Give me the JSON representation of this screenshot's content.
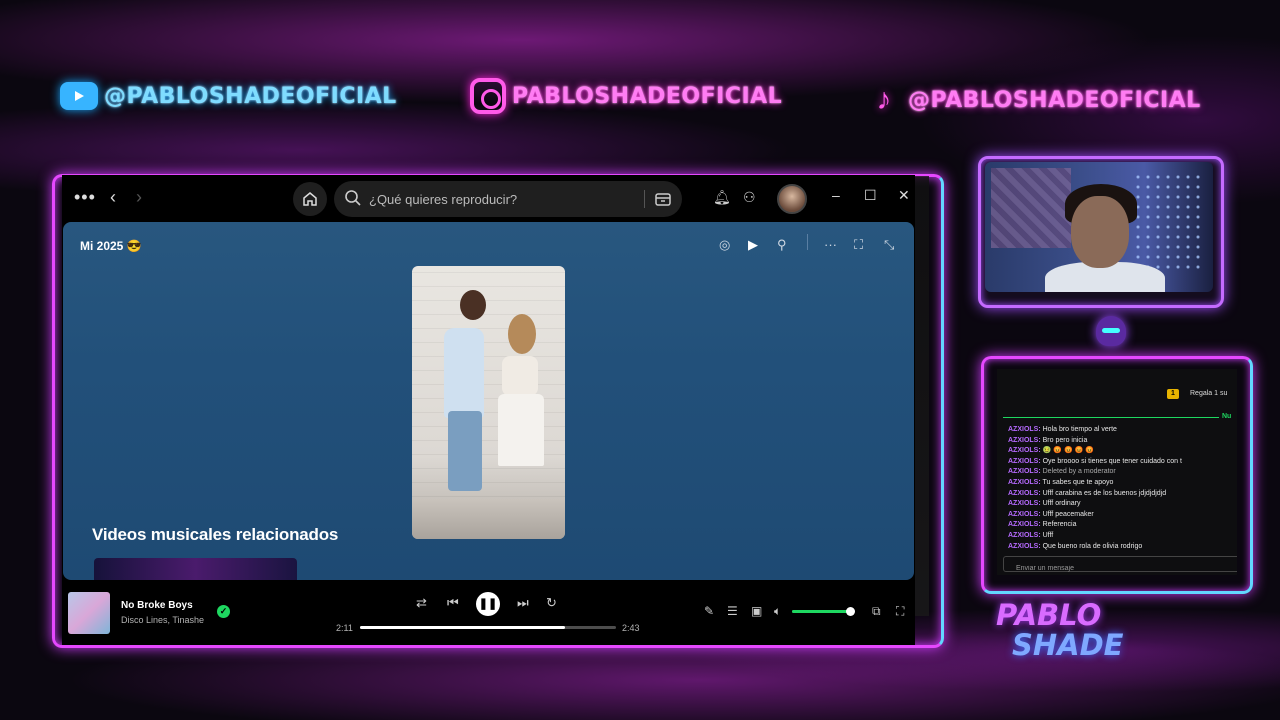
{
  "overlay": {
    "socials": [
      {
        "platform": "youtube",
        "icon": "youtube-icon",
        "handle": "@PABLOSHADEOFICIAL"
      },
      {
        "platform": "instagram",
        "icon": "instagram-icon",
        "handle": "PABLOSHADEOFICIAL"
      },
      {
        "platform": "tiktok",
        "icon": "tiktok-icon",
        "handle": "@PABLOSHADEOFICIAL"
      }
    ],
    "brand": {
      "line1": "PABLO",
      "line2": "SHADE"
    },
    "colors": {
      "neon_pink": "#e548ff",
      "neon_cyan": "#63d7ff",
      "spotify_green": "#1ed760"
    }
  },
  "spotify": {
    "titlebar": {
      "menu_icon": "more-icon",
      "back_icon": "chevron-left-icon",
      "forward_icon": "chevron-right-icon",
      "home_icon": "home-icon",
      "search_placeholder": "¿Qué quieres reproducir?",
      "browse_icon": "browse-icon",
      "notifications_icon": "bell-icon",
      "friends_icon": "friends-icon",
      "avatar_icon": "avatar"
    },
    "now_playing_view": {
      "playlist_title": "Mi 2025 😎",
      "related_heading": "Videos musicales relacionados"
    },
    "player": {
      "track_title": "No Broke Boys",
      "track_artist": "Disco Lines, Tinashe",
      "time_current": "2:11",
      "time_total": "2:43",
      "progress_fraction": 0.8,
      "volume_fraction": 0.97
    }
  },
  "chat": {
    "gift_badge": "1",
    "gift_text": "Regala 1 su",
    "new_label": "Nu",
    "messages": [
      {
        "user": "AZXIOLS:",
        "text": " Hola bro tiempo al verte"
      },
      {
        "user": "AZXIOLS:",
        "text": " Bro pero inicia"
      },
      {
        "user": "AZXIOLS:",
        "text": " 🤢 😡 😡 😡 😡"
      },
      {
        "user": "AZXIOLS:",
        "text": " Oye broooo si tienes que tener cuidado con t"
      },
      {
        "user": "AZXIOLS:",
        "text": " Deleted by a moderator",
        "deleted": true
      },
      {
        "user": "AZXIOLS:",
        "text": " Tu sabes que te apoyo"
      },
      {
        "user": "AZXIOLS:",
        "text": " Ufff carabina es de los buenos jdjdjdjdjd"
      },
      {
        "user": "AZXIOLS:",
        "text": " Ufff ordinary"
      },
      {
        "user": "AZXIOLS:",
        "text": " Ufff peacemaker"
      },
      {
        "user": "AZXIOLS:",
        "text": " Referencia"
      },
      {
        "user": "AZXIOLS:",
        "text": " Ufff"
      },
      {
        "user": "AZXIOLS:",
        "text": " Que bueno rola de olivia rodrigo"
      }
    ],
    "input_placeholder": "Enviar un mensaje"
  }
}
